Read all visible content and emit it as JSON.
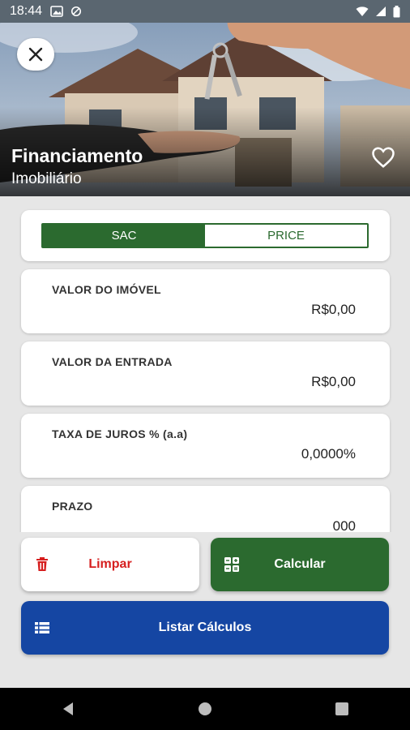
{
  "status": {
    "time": "18:44"
  },
  "hero": {
    "title": "Financiamento",
    "subtitle": "Imobiliário"
  },
  "modes": {
    "options": [
      "SAC",
      "PRICE"
    ],
    "selected": "SAC"
  },
  "fields": [
    {
      "label": "VALOR DO IMÓVEL",
      "value": "R$0,00"
    },
    {
      "label": "VALOR DA ENTRADA",
      "value": "R$0,00"
    },
    {
      "label": "TAXA DE JUROS % (a.a)",
      "value": "0,0000%"
    },
    {
      "label": "PRAZO",
      "value": "000"
    }
  ],
  "actions": {
    "clear": "Limpar",
    "calculate": "Calcular",
    "list": "Listar Cálculos"
  },
  "colors": {
    "primary_green": "#2b6a2f",
    "clear_red": "#d61f1f",
    "list_blue": "#1546a3"
  }
}
